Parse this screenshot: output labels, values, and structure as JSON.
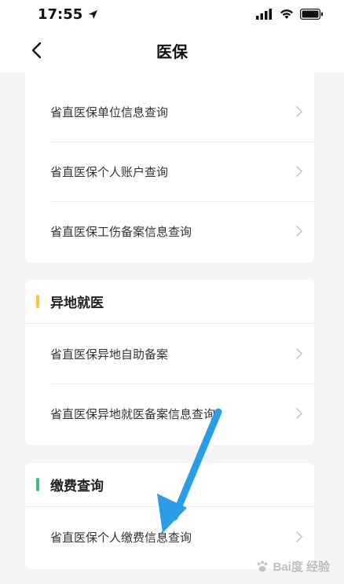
{
  "status_bar": {
    "time": "17:55"
  },
  "nav": {
    "title": "医保"
  },
  "sections": [
    {
      "title": "",
      "items": [
        {
          "label": "省直医保单位信息查询"
        },
        {
          "label": "省直医保个人账户查询"
        },
        {
          "label": "省直医保工伤备案信息查询"
        }
      ]
    },
    {
      "title": "异地就医",
      "accent": "#f5c842",
      "items": [
        {
          "label": "省直医保异地自助备案"
        },
        {
          "label": "省直医保异地就医备案信息查询"
        }
      ]
    },
    {
      "title": "缴费查询",
      "accent": "#3ec07a",
      "items": [
        {
          "label": "省直医保个人缴费信息查询"
        }
      ]
    }
  ],
  "colors": {
    "annotation_arrow": "#2a9de8",
    "divider": "#ececec",
    "background": "#f5f5f7"
  },
  "watermark": {
    "text": "Bai度 经验"
  }
}
